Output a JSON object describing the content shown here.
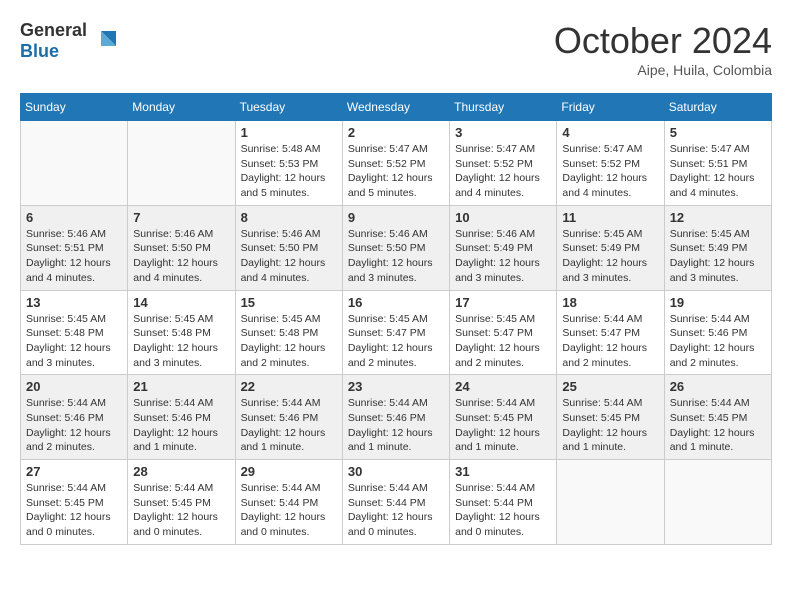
{
  "app": {
    "name_general": "General",
    "name_blue": "Blue"
  },
  "header": {
    "month": "October 2024",
    "location": "Aipe, Huila, Colombia"
  },
  "weekdays": [
    "Sunday",
    "Monday",
    "Tuesday",
    "Wednesday",
    "Thursday",
    "Friday",
    "Saturday"
  ],
  "weeks": [
    [
      {
        "day": "",
        "sunrise": "",
        "sunset": "",
        "daylight": ""
      },
      {
        "day": "",
        "sunrise": "",
        "sunset": "",
        "daylight": ""
      },
      {
        "day": "1",
        "sunrise": "Sunrise: 5:48 AM",
        "sunset": "Sunset: 5:53 PM",
        "daylight": "Daylight: 12 hours and 5 minutes."
      },
      {
        "day": "2",
        "sunrise": "Sunrise: 5:47 AM",
        "sunset": "Sunset: 5:52 PM",
        "daylight": "Daylight: 12 hours and 5 minutes."
      },
      {
        "day": "3",
        "sunrise": "Sunrise: 5:47 AM",
        "sunset": "Sunset: 5:52 PM",
        "daylight": "Daylight: 12 hours and 4 minutes."
      },
      {
        "day": "4",
        "sunrise": "Sunrise: 5:47 AM",
        "sunset": "Sunset: 5:52 PM",
        "daylight": "Daylight: 12 hours and 4 minutes."
      },
      {
        "day": "5",
        "sunrise": "Sunrise: 5:47 AM",
        "sunset": "Sunset: 5:51 PM",
        "daylight": "Daylight: 12 hours and 4 minutes."
      }
    ],
    [
      {
        "day": "6",
        "sunrise": "Sunrise: 5:46 AM",
        "sunset": "Sunset: 5:51 PM",
        "daylight": "Daylight: 12 hours and 4 minutes."
      },
      {
        "day": "7",
        "sunrise": "Sunrise: 5:46 AM",
        "sunset": "Sunset: 5:50 PM",
        "daylight": "Daylight: 12 hours and 4 minutes."
      },
      {
        "day": "8",
        "sunrise": "Sunrise: 5:46 AM",
        "sunset": "Sunset: 5:50 PM",
        "daylight": "Daylight: 12 hours and 4 minutes."
      },
      {
        "day": "9",
        "sunrise": "Sunrise: 5:46 AM",
        "sunset": "Sunset: 5:50 PM",
        "daylight": "Daylight: 12 hours and 3 minutes."
      },
      {
        "day": "10",
        "sunrise": "Sunrise: 5:46 AM",
        "sunset": "Sunset: 5:49 PM",
        "daylight": "Daylight: 12 hours and 3 minutes."
      },
      {
        "day": "11",
        "sunrise": "Sunrise: 5:45 AM",
        "sunset": "Sunset: 5:49 PM",
        "daylight": "Daylight: 12 hours and 3 minutes."
      },
      {
        "day": "12",
        "sunrise": "Sunrise: 5:45 AM",
        "sunset": "Sunset: 5:49 PM",
        "daylight": "Daylight: 12 hours and 3 minutes."
      }
    ],
    [
      {
        "day": "13",
        "sunrise": "Sunrise: 5:45 AM",
        "sunset": "Sunset: 5:48 PM",
        "daylight": "Daylight: 12 hours and 3 minutes."
      },
      {
        "day": "14",
        "sunrise": "Sunrise: 5:45 AM",
        "sunset": "Sunset: 5:48 PM",
        "daylight": "Daylight: 12 hours and 3 minutes."
      },
      {
        "day": "15",
        "sunrise": "Sunrise: 5:45 AM",
        "sunset": "Sunset: 5:48 PM",
        "daylight": "Daylight: 12 hours and 2 minutes."
      },
      {
        "day": "16",
        "sunrise": "Sunrise: 5:45 AM",
        "sunset": "Sunset: 5:47 PM",
        "daylight": "Daylight: 12 hours and 2 minutes."
      },
      {
        "day": "17",
        "sunrise": "Sunrise: 5:45 AM",
        "sunset": "Sunset: 5:47 PM",
        "daylight": "Daylight: 12 hours and 2 minutes."
      },
      {
        "day": "18",
        "sunrise": "Sunrise: 5:44 AM",
        "sunset": "Sunset: 5:47 PM",
        "daylight": "Daylight: 12 hours and 2 minutes."
      },
      {
        "day": "19",
        "sunrise": "Sunrise: 5:44 AM",
        "sunset": "Sunset: 5:46 PM",
        "daylight": "Daylight: 12 hours and 2 minutes."
      }
    ],
    [
      {
        "day": "20",
        "sunrise": "Sunrise: 5:44 AM",
        "sunset": "Sunset: 5:46 PM",
        "daylight": "Daylight: 12 hours and 2 minutes."
      },
      {
        "day": "21",
        "sunrise": "Sunrise: 5:44 AM",
        "sunset": "Sunset: 5:46 PM",
        "daylight": "Daylight: 12 hours and 1 minute."
      },
      {
        "day": "22",
        "sunrise": "Sunrise: 5:44 AM",
        "sunset": "Sunset: 5:46 PM",
        "daylight": "Daylight: 12 hours and 1 minute."
      },
      {
        "day": "23",
        "sunrise": "Sunrise: 5:44 AM",
        "sunset": "Sunset: 5:46 PM",
        "daylight": "Daylight: 12 hours and 1 minute."
      },
      {
        "day": "24",
        "sunrise": "Sunrise: 5:44 AM",
        "sunset": "Sunset: 5:45 PM",
        "daylight": "Daylight: 12 hours and 1 minute."
      },
      {
        "day": "25",
        "sunrise": "Sunrise: 5:44 AM",
        "sunset": "Sunset: 5:45 PM",
        "daylight": "Daylight: 12 hours and 1 minute."
      },
      {
        "day": "26",
        "sunrise": "Sunrise: 5:44 AM",
        "sunset": "Sunset: 5:45 PM",
        "daylight": "Daylight: 12 hours and 1 minute."
      }
    ],
    [
      {
        "day": "27",
        "sunrise": "Sunrise: 5:44 AM",
        "sunset": "Sunset: 5:45 PM",
        "daylight": "Daylight: 12 hours and 0 minutes."
      },
      {
        "day": "28",
        "sunrise": "Sunrise: 5:44 AM",
        "sunset": "Sunset: 5:45 PM",
        "daylight": "Daylight: 12 hours and 0 minutes."
      },
      {
        "day": "29",
        "sunrise": "Sunrise: 5:44 AM",
        "sunset": "Sunset: 5:44 PM",
        "daylight": "Daylight: 12 hours and 0 minutes."
      },
      {
        "day": "30",
        "sunrise": "Sunrise: 5:44 AM",
        "sunset": "Sunset: 5:44 PM",
        "daylight": "Daylight: 12 hours and 0 minutes."
      },
      {
        "day": "31",
        "sunrise": "Sunrise: 5:44 AM",
        "sunset": "Sunset: 5:44 PM",
        "daylight": "Daylight: 12 hours and 0 minutes."
      },
      {
        "day": "",
        "sunrise": "",
        "sunset": "",
        "daylight": ""
      },
      {
        "day": "",
        "sunrise": "",
        "sunset": "",
        "daylight": ""
      }
    ]
  ]
}
